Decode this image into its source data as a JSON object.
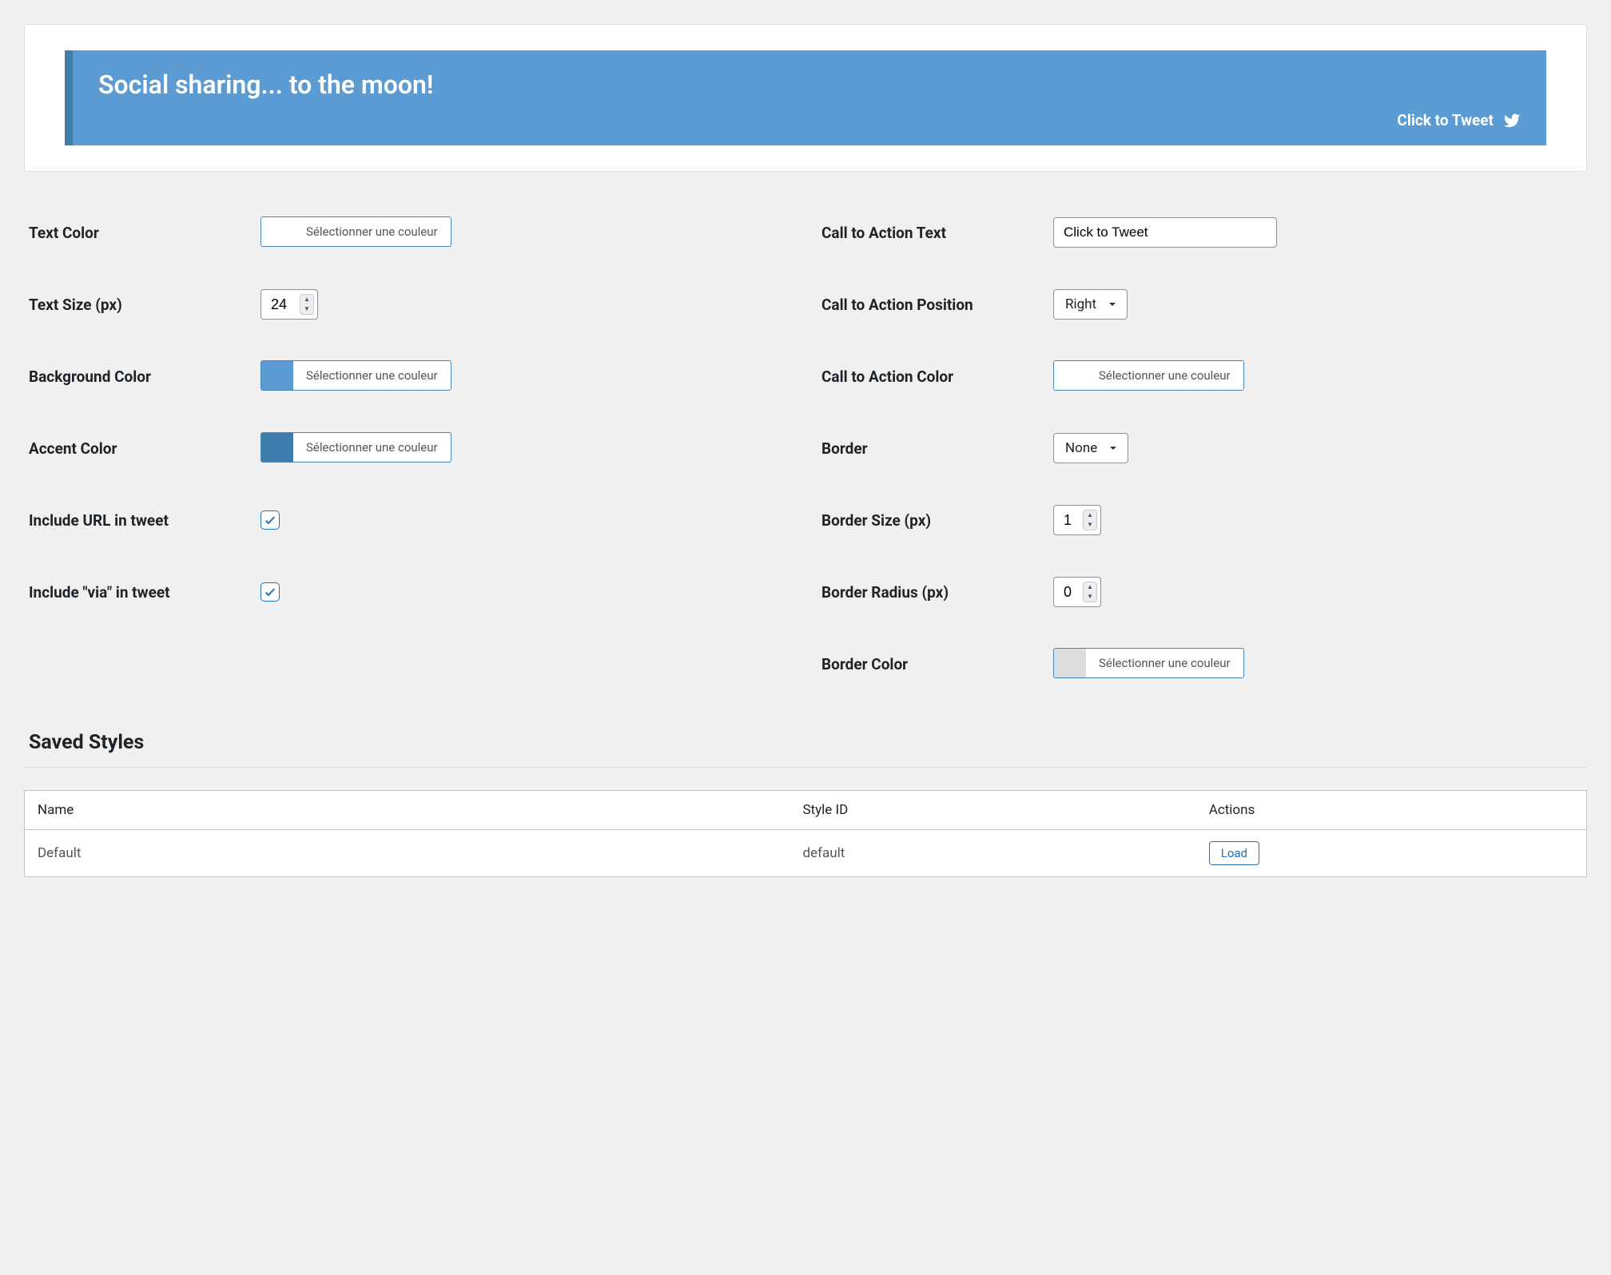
{
  "preview": {
    "text": "Social sharing... to the moon!",
    "cta": "Click to Tweet"
  },
  "colors": {
    "text": "#ffffff",
    "background": "#5a9bd3",
    "accent": "#3f7dad",
    "cta": "#ffffff",
    "border": "#dddddd"
  },
  "labels": {
    "text_color": "Text Color",
    "text_size": "Text Size (px)",
    "bg_color": "Background Color",
    "accent_color": "Accent Color",
    "include_url": "Include URL in tweet",
    "include_via": "Include \"via\" in tweet",
    "cta_text": "Call to Action Text",
    "cta_position": "Call to Action Position",
    "cta_color": "Call to Action Color",
    "border": "Border",
    "border_size": "Border Size (px)",
    "border_radius": "Border Radius (px)",
    "border_color": "Border Color",
    "pick_color": "Sélectionner une couleur",
    "saved_styles": "Saved Styles"
  },
  "values": {
    "text_size": "24",
    "cta_text": "Click to Tweet",
    "cta_position": "Right",
    "border": "None",
    "border_size": "1",
    "border_radius": "0",
    "include_url": true,
    "include_via": true
  },
  "table": {
    "headers": {
      "name": "Name",
      "style_id": "Style ID",
      "actions": "Actions"
    },
    "rows": [
      {
        "name": "Default",
        "style_id": "default",
        "action": "Load"
      }
    ]
  }
}
